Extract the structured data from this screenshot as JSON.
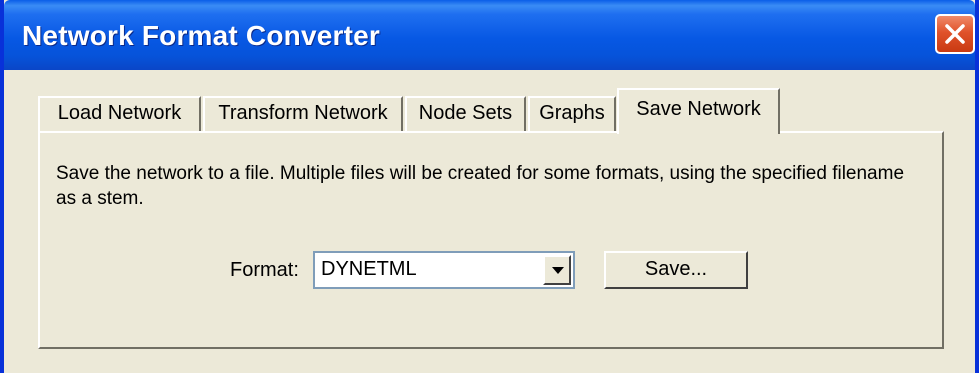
{
  "window": {
    "title": "Network Format Converter"
  },
  "tabs": [
    {
      "label": "Load Network",
      "active": false
    },
    {
      "label": "Transform Network",
      "active": false
    },
    {
      "label": "Node Sets",
      "active": false
    },
    {
      "label": "Graphs",
      "active": false
    },
    {
      "label": "Save Network",
      "active": true
    }
  ],
  "save_panel": {
    "description": "Save the network to a file.  Multiple files will be created for some formats, using the specified filename as a stem.",
    "format_label": "Format:",
    "format_value": "DYNETML",
    "save_button_label": "Save..."
  },
  "icons": {
    "close": "close-icon",
    "dropdown": "chevron-down-icon"
  },
  "colors": {
    "titlebar": "#0758e4",
    "close_button": "#e0522a",
    "dialog_background": "#ece9d8"
  }
}
